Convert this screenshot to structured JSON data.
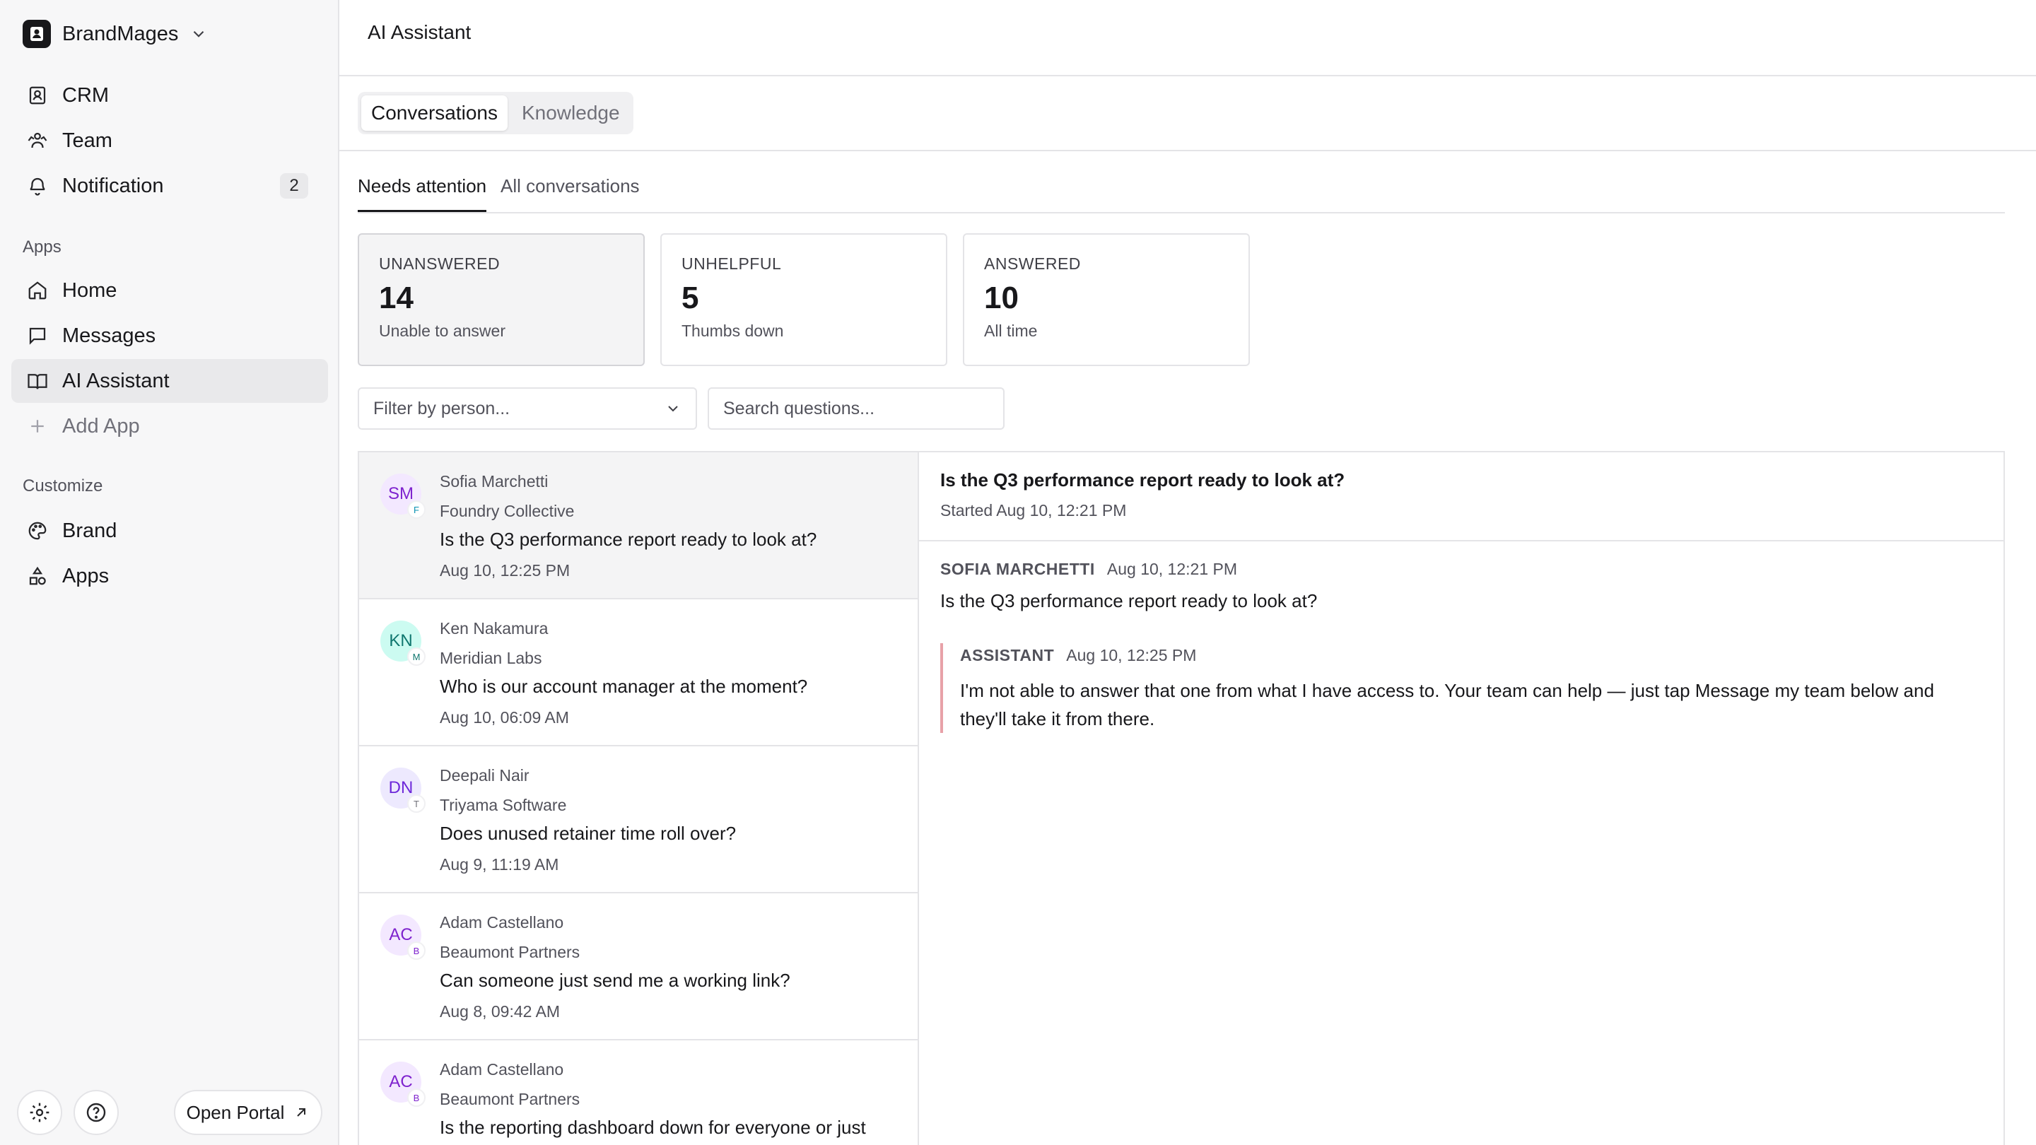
{
  "workspace": {
    "name": "BrandMages"
  },
  "sidebar": {
    "top_items": [
      {
        "label": "CRM",
        "icon": "contact-book-icon"
      },
      {
        "label": "Team",
        "icon": "team-icon"
      },
      {
        "label": "Notification",
        "icon": "bell-icon",
        "badge": "2"
      }
    ],
    "apps_label": "Apps",
    "app_items": [
      {
        "label": "Home",
        "icon": "home-icon"
      },
      {
        "label": "Messages",
        "icon": "message-square-icon"
      },
      {
        "label": "AI Assistant",
        "icon": "book-open-icon",
        "active": true
      },
      {
        "label": "Add App",
        "icon": "plus-icon"
      }
    ],
    "customize_label": "Customize",
    "customize_items": [
      {
        "label": "Brand",
        "icon": "palette-icon"
      },
      {
        "label": "Apps",
        "icon": "shapes-icon"
      }
    ],
    "open_portal": "Open Portal"
  },
  "page": {
    "title": "AI Assistant",
    "tabs": [
      "Conversations",
      "Knowledge"
    ],
    "active_tab": "Conversations",
    "subtabs": [
      "Needs attention",
      "All conversations"
    ],
    "active_subtab": "Needs attention"
  },
  "stats": [
    {
      "label": "UNANSWERED",
      "value": "14",
      "sub": "Unable to answer"
    },
    {
      "label": "UNHELPFUL",
      "value": "5",
      "sub": "Thumbs down"
    },
    {
      "label": "ANSWERED",
      "value": "10",
      "sub": "All time"
    }
  ],
  "filter": {
    "placeholder": "Filter by person..."
  },
  "search": {
    "placeholder": "Search questions..."
  },
  "conversations": [
    {
      "initials": "SM",
      "org_initial": "F",
      "name": "Sofia Marchetti",
      "org": "Foundry Collective",
      "question": "Is the Q3 performance report ready to look at?",
      "time": "Aug 10, 12:25 PM"
    },
    {
      "initials": "KN",
      "org_initial": "M",
      "name": "Ken Nakamura",
      "org": "Meridian Labs",
      "question": "Who is our account manager at the moment?",
      "time": "Aug 10, 06:09 AM"
    },
    {
      "initials": "DN",
      "org_initial": "T",
      "name": "Deepali Nair",
      "org": "Triyama Software",
      "question": "Does unused retainer time roll over?",
      "time": "Aug 9, 11:19 AM"
    },
    {
      "initials": "AC",
      "org_initial": "B",
      "name": "Adam Castellano",
      "org": "Beaumont Partners",
      "question": "Can someone just send me a working link?",
      "time": "Aug 8, 09:42 AM"
    },
    {
      "initials": "AC",
      "org_initial": "B",
      "name": "Adam Castellano",
      "org": "Beaumont Partners",
      "question": "Is the reporting dashboard down for everyone or just",
      "time": ""
    }
  ],
  "detail": {
    "title": "Is the Q3 performance report ready to look at?",
    "started": "Started Aug 10, 12:21 PM",
    "user_author": "SOFIA MARCHETTI",
    "user_time": "Aug 10, 12:21 PM",
    "user_text": "Is the Q3 performance report ready to look at?",
    "assistant_author": "ASSISTANT",
    "assistant_time": "Aug 10, 12:25 PM",
    "assistant_text": "I'm not able to answer that one from what I have access to. Your team can help — just tap Message my team below and they'll take it from there."
  },
  "colors": {
    "avatar_sm": "#7e22ce",
    "avatar_kn": "#0f766e",
    "avatar_dn": "#6d28d9",
    "avatar_ac": "#7e22ce",
    "reply_border": "#e8a1a8"
  }
}
